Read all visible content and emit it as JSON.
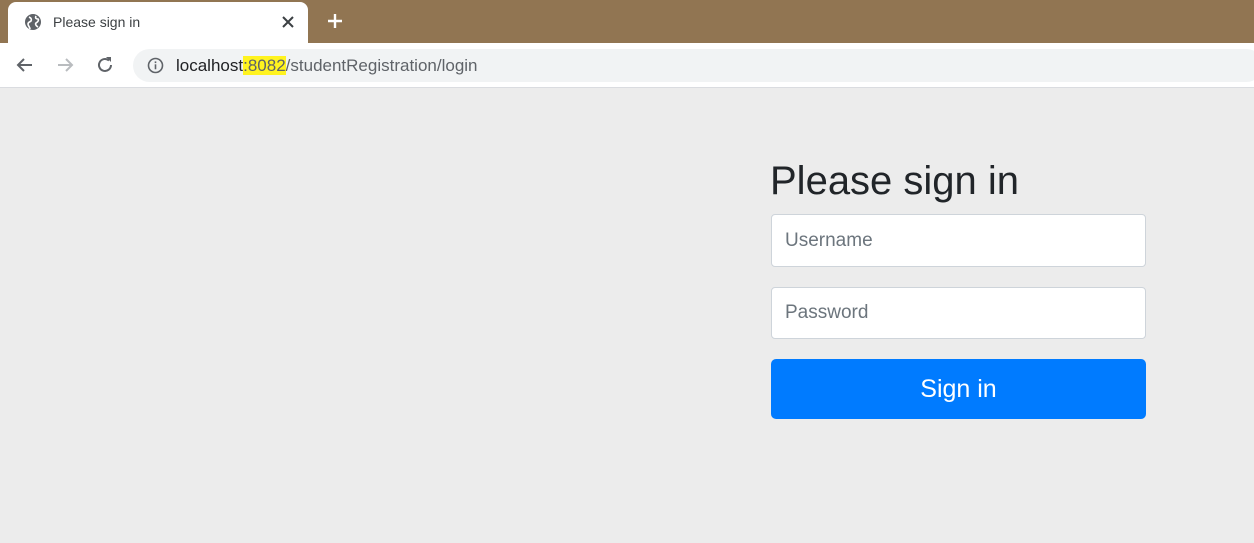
{
  "browser": {
    "tab": {
      "title": "Please sign in",
      "favicon": "globe-icon"
    },
    "toolbar": {
      "back_icon": "back-arrow-icon",
      "forward_icon": "forward-arrow-icon",
      "reload_icon": "reload-icon",
      "info_icon": "info-icon"
    },
    "url": {
      "host": "localhost",
      "port_sep": ":",
      "port": "8082",
      "path": "/studentRegistration/login"
    }
  },
  "login": {
    "heading": "Please sign in",
    "username_placeholder": "Username",
    "password_placeholder": "Password",
    "submit_label": "Sign in"
  },
  "colors": {
    "tabstrip": "#917552",
    "page_background": "#ececec",
    "primary_button": "#007bff",
    "url_highlight": "#fff31f"
  }
}
